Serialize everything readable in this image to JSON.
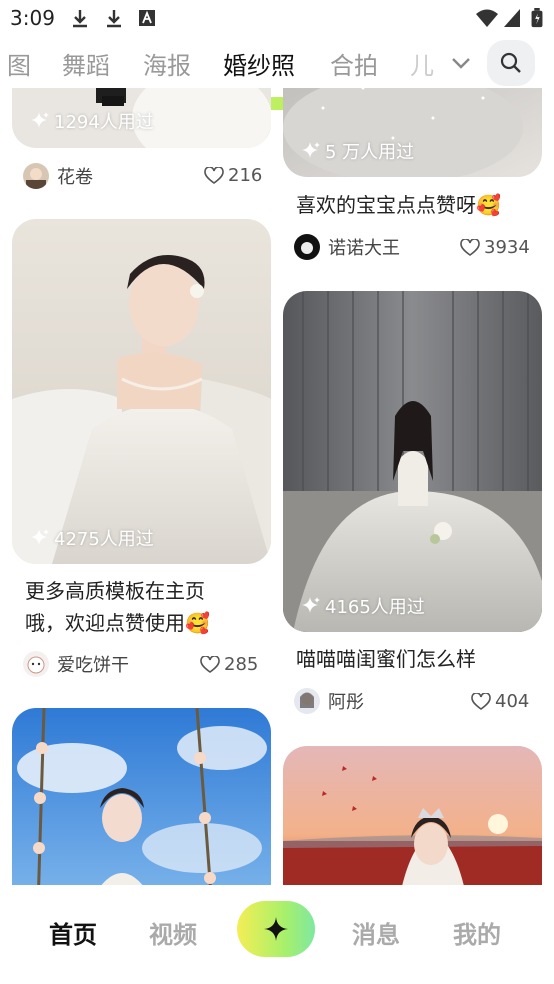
{
  "status_bar": {
    "time": "3:09"
  },
  "tabs": [
    {
      "label": "图",
      "active": false
    },
    {
      "label": "舞蹈",
      "active": false
    },
    {
      "label": "海报",
      "active": false
    },
    {
      "label": "婚纱照",
      "active": true
    },
    {
      "label": "合拍",
      "active": false
    },
    {
      "label": "儿",
      "active": false
    }
  ],
  "feed": {
    "left": [
      {
        "used": "1294人用过",
        "title": "",
        "author": "花卷",
        "likes": "216"
      },
      {
        "used": "4275人用过",
        "title_line1": "更多高质模板在主页",
        "title_line2": "哦，欢迎点赞使用🥰",
        "author": "爱吃饼干",
        "likes": "285"
      },
      {
        "used": "",
        "title": "",
        "author": "",
        "likes": ""
      }
    ],
    "right": [
      {
        "used": "5 万人用过",
        "title": "喜欢的宝宝点点赞呀🥰",
        "author": "诺诺大王",
        "likes": "3934"
      },
      {
        "used": "4165人用过",
        "title": "喵喵喵闺蜜们怎么样",
        "author": "阿彤",
        "likes": "404"
      },
      {
        "used": "",
        "title": "",
        "author": "",
        "likes": ""
      }
    ]
  },
  "bottom_nav": {
    "home": "首页",
    "video": "视频",
    "messages": "消息",
    "mine": "我的"
  },
  "icons": {
    "search": "search-icon",
    "sparkle": "sparkle-icon",
    "heart": "heart-icon",
    "chevron": "chevron-down-icon",
    "create": "sparkle-icon"
  },
  "colors": {
    "accent": "#b9ee55"
  }
}
